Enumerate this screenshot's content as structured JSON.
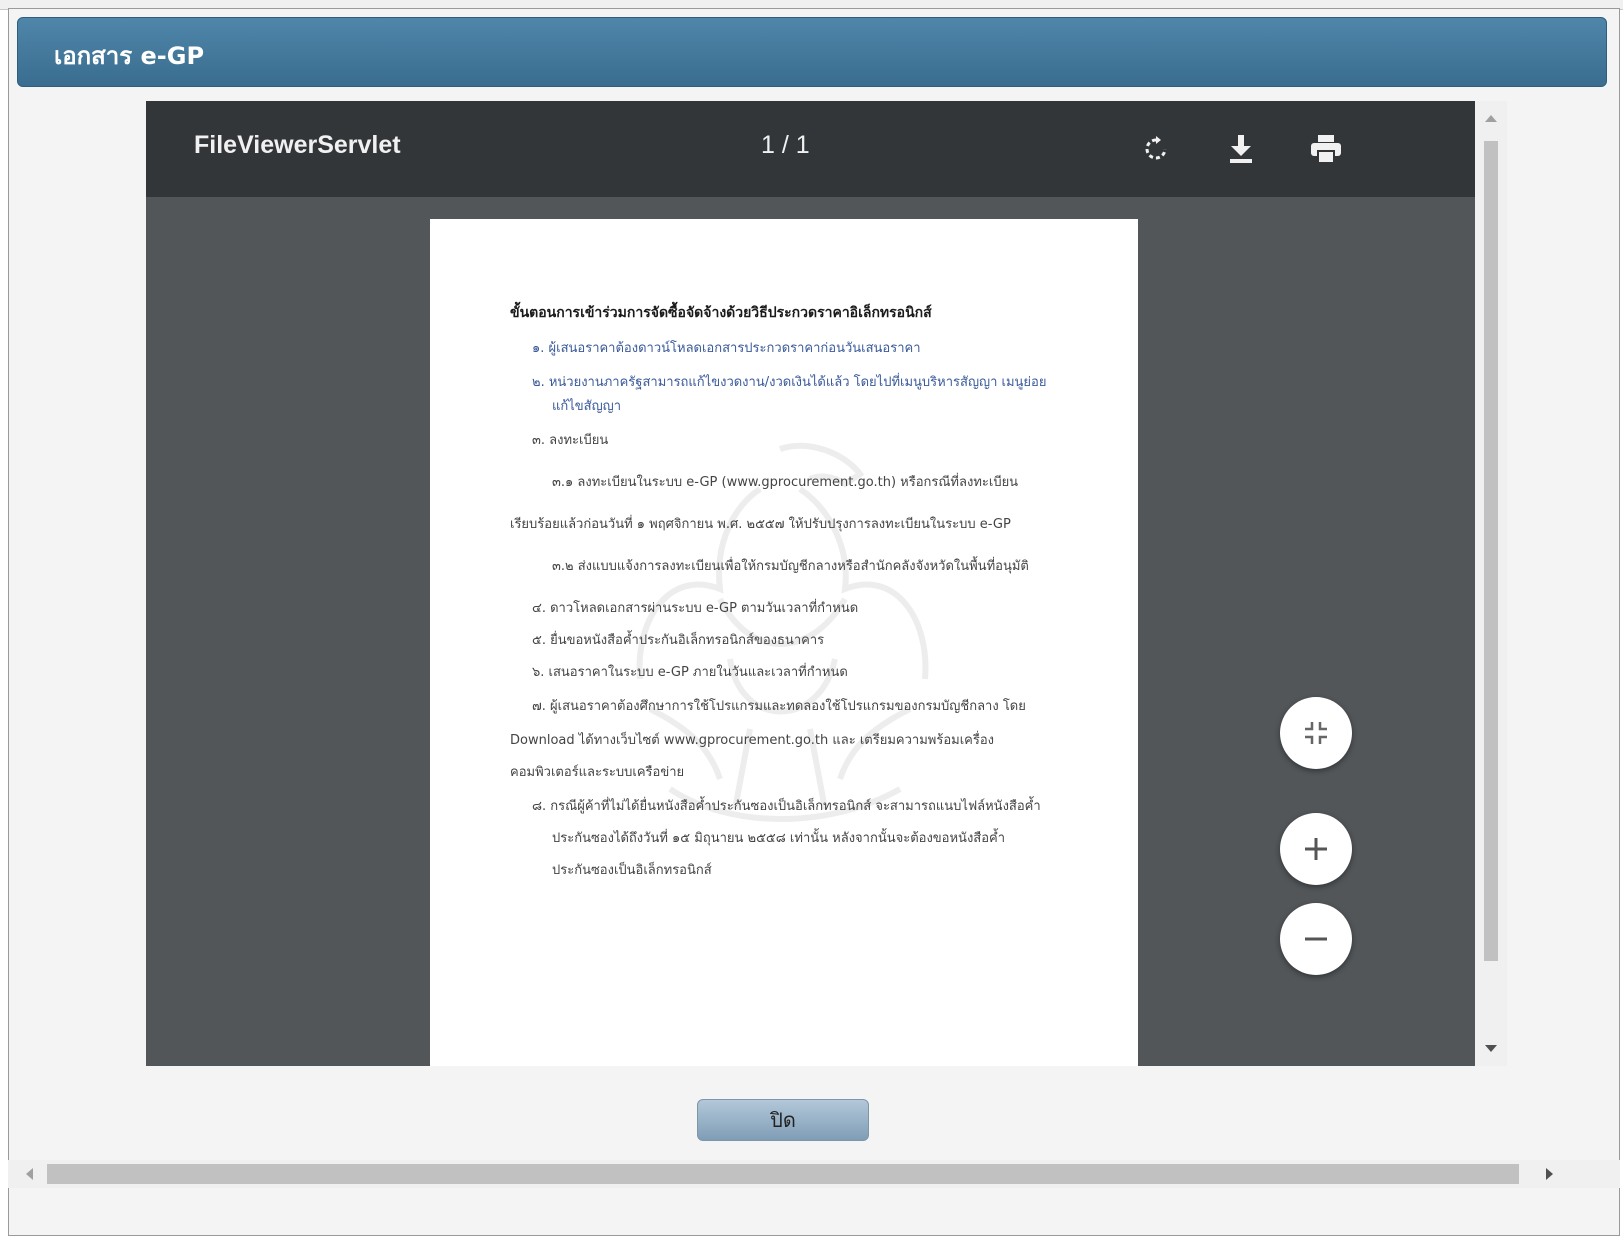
{
  "dialog": {
    "title": "เอกสาร e-GP",
    "close_label": "ปิด"
  },
  "viewer": {
    "file_name": "FileViewerServlet",
    "page_indicator": "1 / 1",
    "icons": {
      "rotate": "rotate-icon",
      "download": "download-icon",
      "print": "print-icon"
    },
    "controls": {
      "fit": "fit-page-icon",
      "zoom_in": "zoom-in-icon",
      "zoom_out": "zoom-out-icon"
    }
  },
  "document": {
    "heading": "ขั้นตอนการเข้าร่วมการจัดซื้อจัดจ้างด้วยวิธีประกวดราคาอิเล็กทรอนิกส์",
    "lines": [
      "๑. ผู้เสนอราคาต้องดาวน์โหลดเอกสารประกวดราคาก่อนวันเสนอราคา",
      "๒. หน่วยงานภาครัฐสามารถแก้ไขงวดงาน/งวดเงินได้แล้ว โดยไปที่เมนูบริหารสัญญา เมนูย่อย",
      "แก้ไขสัญญา",
      "๓. ลงทะเบียน",
      "๓.๑ ลงทะเบียนในระบบ e-GP (www.gprocurement.go.th) หรือกรณีที่ลงทะเบียน",
      "เรียบร้อยแล้วก่อนวันที่ ๑ พฤศจิกายน พ.ศ. ๒๕๕๗ ให้ปรับปรุงการลงทะเบียนในระบบ e-GP",
      "๓.๒ ส่งแบบแจ้งการลงทะเบียนเพื่อให้กรมบัญชีกลางหรือสำนักคลังจังหวัดในพื้นที่อนุมัติ",
      "๔. ดาวโหลดเอกสารผ่านระบบ e-GP ตามวันเวลาที่กำหนด",
      "๕. ยื่นขอหนังสือค้ำประกันอิเล็กทรอนิกส์ของธนาคาร",
      "๖. เสนอราคาในระบบ e-GP ภายในวันและเวลาที่กำหนด",
      "๗. ผู้เสนอราคาต้องศึกษาการใช้โปรแกรมและทดลองใช้โปรแกรมของกรมบัญชีกลาง โดย",
      "Download ได้ทางเว็บไซต์ www.gprocurement.go.th และ เตรียมความพร้อมเครื่อง",
      "คอมพิวเตอร์และระบบเครือข่าย",
      "๘. กรณีผู้ค้าที่ไม่ได้ยื่นหนังสือค้ำประกันซองเป็นอิเล็กทรอนิกส์ จะสามารถแนบไฟล์หนังสือค้ำ",
      "ประกันซองได้ถึงวันที่ ๑๕ มิถุนายน ๒๕๕๘ เท่านั้น หลังจากนั้นจะต้องขอหนังสือค้ำ",
      "ประกันซองเป็นอิเล็กทรอนิกส์"
    ]
  },
  "colors": {
    "header": "#3f759a",
    "viewer_bg": "#525659",
    "toolbar_bg": "#323639",
    "link_text": "#3a5a9a"
  }
}
